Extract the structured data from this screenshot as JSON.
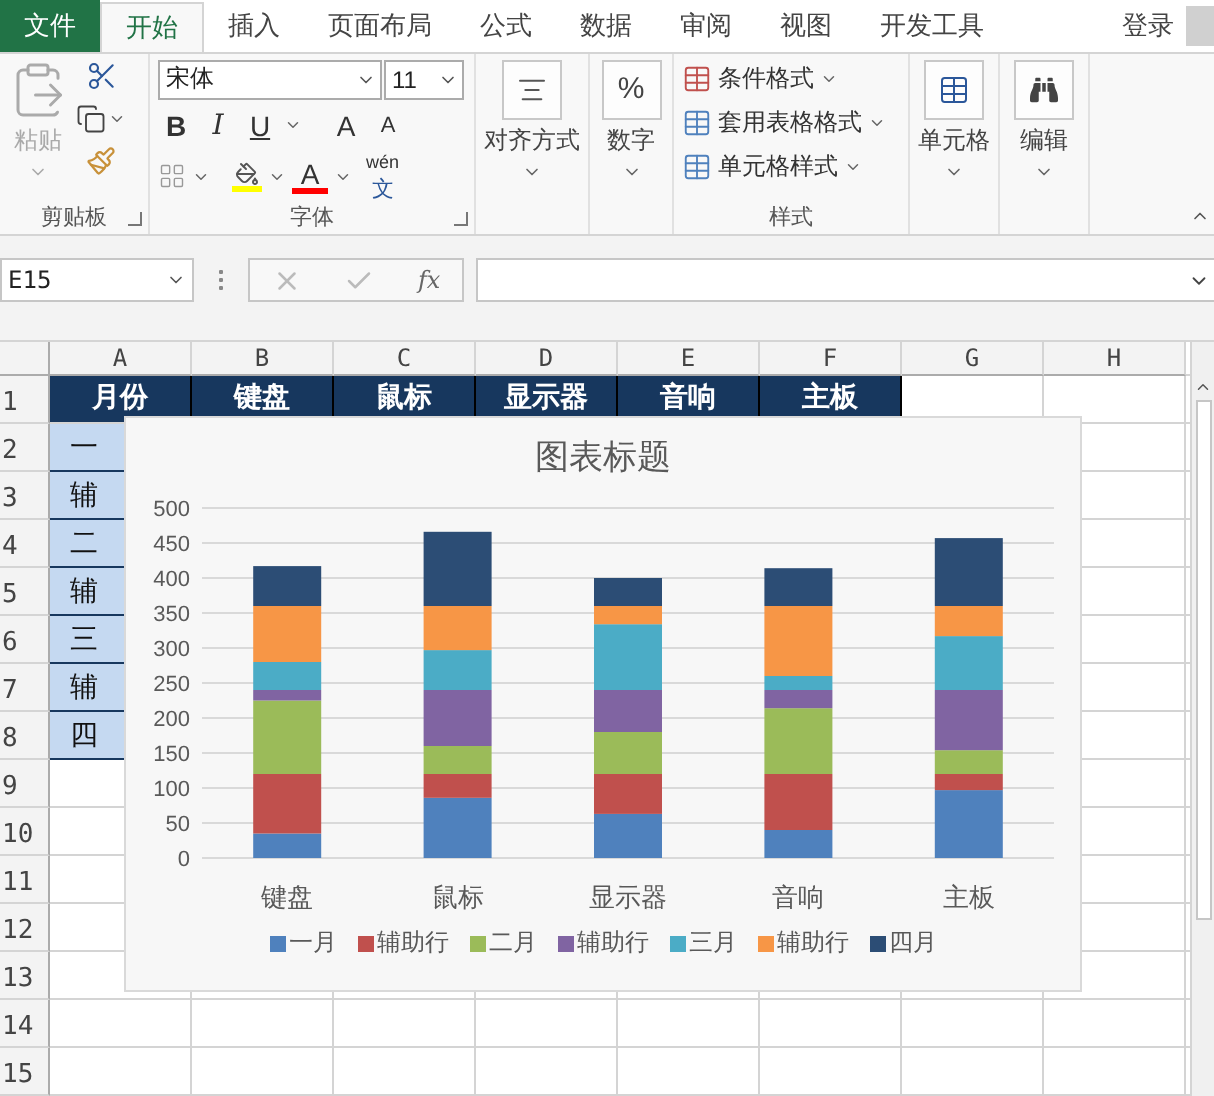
{
  "tabs": [
    {
      "label": "文件",
      "kind": "file",
      "selected": false
    },
    {
      "label": "开始",
      "kind": "tab",
      "selected": true
    },
    {
      "label": "插入",
      "kind": "tab",
      "selected": false
    },
    {
      "label": "页面布局",
      "kind": "tab",
      "selected": false
    },
    {
      "label": "公式",
      "kind": "tab",
      "selected": false
    },
    {
      "label": "数据",
      "kind": "tab",
      "selected": false
    },
    {
      "label": "审阅",
      "kind": "tab",
      "selected": false
    },
    {
      "label": "视图",
      "kind": "tab",
      "selected": false
    },
    {
      "label": "开发工具",
      "kind": "tab",
      "selected": false
    }
  ],
  "account": {
    "label": "登录"
  },
  "clipboard": {
    "label": "剪贴板",
    "paste": "粘贴"
  },
  "font": {
    "label": "字体",
    "family": "宋体",
    "size": "11",
    "bold": "B",
    "italic": "I",
    "underline": "U",
    "grow": "A",
    "shrink": "A",
    "color_letter": "A",
    "phonetic": "wén",
    "phonetic_char": "文"
  },
  "alignment": {
    "label": "对齐方式"
  },
  "number": {
    "label": "数字",
    "symbol": "%"
  },
  "styles": {
    "label": "样式",
    "items": [
      "条件格式",
      "套用表格格式",
      "单元格样式"
    ]
  },
  "cells": {
    "label": "单元格"
  },
  "editing": {
    "label": "编辑"
  },
  "formula_bar": {
    "name_box": "E15",
    "function": "fx"
  },
  "sheet": {
    "columns": [
      "A",
      "B",
      "C",
      "D",
      "E",
      "F",
      "G",
      "H"
    ],
    "rows": [
      "1",
      "2",
      "3",
      "4",
      "5",
      "6",
      "7",
      "8",
      "9",
      "10",
      "11",
      "12",
      "13",
      "14",
      "15"
    ],
    "header_row": [
      "月份",
      "键盘",
      "鼠标",
      "显示器",
      "音响",
      "主板"
    ],
    "column_a": [
      "一",
      "辅",
      "二",
      "辅",
      "三",
      "辅",
      "四"
    ]
  },
  "chart": {
    "chart_data": {
      "type": "bar",
      "title": "图表标题",
      "stacked": true,
      "orientation": "vertical",
      "grid": true,
      "categories": [
        "键盘",
        "鼠标",
        "显示器",
        "音响",
        "主板"
      ],
      "ylim": [
        0,
        500
      ],
      "yticks": [
        0,
        50,
        100,
        150,
        200,
        250,
        300,
        350,
        400,
        450,
        500
      ],
      "series": [
        {
          "name": "一月",
          "color": "#4f81bd",
          "values": [
            35,
            86,
            63,
            40,
            97
          ]
        },
        {
          "name": "辅助行",
          "color": "#c0504d",
          "values": [
            85,
            34,
            57,
            80,
            23
          ]
        },
        {
          "name": "二月",
          "color": "#9bbb59",
          "values": [
            105,
            40,
            60,
            94,
            34
          ]
        },
        {
          "name": "辅助行",
          "color": "#8064a2",
          "values": [
            15,
            80,
            60,
            26,
            86
          ]
        },
        {
          "name": "三月",
          "color": "#4bacc6",
          "values": [
            40,
            57,
            94,
            20,
            77
          ]
        },
        {
          "name": "辅助行",
          "color": "#f79646",
          "values": [
            80,
            63,
            26,
            100,
            43
          ]
        },
        {
          "name": "四月",
          "color": "#2c4d75",
          "values": [
            57,
            106,
            40,
            54,
            97
          ]
        }
      ]
    }
  }
}
